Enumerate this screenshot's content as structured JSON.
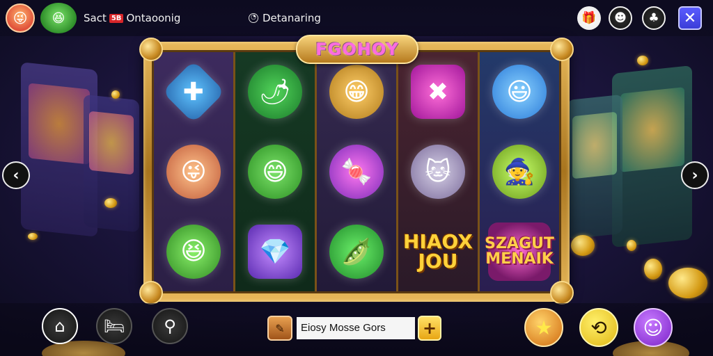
{
  "topbar": {
    "title": "Sact",
    "title_badge": "5B",
    "subtitle": "Ontaoonig",
    "status_text": "Detanaring"
  },
  "game": {
    "title": "FGOHOY",
    "reels": [
      [
        {
          "symbol": "blue-cross-gem",
          "glyph": "✚"
        },
        {
          "symbol": "elf-creature",
          "glyph": "😜"
        },
        {
          "symbol": "green-frog",
          "glyph": "😆"
        }
      ],
      [
        {
          "symbol": "chili-pepper",
          "glyph": "🌶"
        },
        {
          "symbol": "green-blob",
          "glyph": "😄"
        },
        {
          "symbol": "purple-crystal",
          "glyph": "💎"
        }
      ],
      [
        {
          "symbol": "golden-goblin",
          "glyph": "😁"
        },
        {
          "symbol": "candy-orb",
          "glyph": "🍬"
        },
        {
          "symbol": "green-bean",
          "glyph": "🫛"
        }
      ],
      [
        {
          "symbol": "pink-x-gem",
          "glyph": "✖"
        },
        {
          "symbol": "grey-cat",
          "glyph": "🐱"
        },
        {
          "symbol": "word-hiaox-jou",
          "line1": "HIAOX",
          "line2": "JOU"
        }
      ],
      [
        {
          "symbol": "blue-blob",
          "glyph": "😃"
        },
        {
          "symbol": "wizard",
          "glyph": "🧙"
        },
        {
          "symbol": "word-szagut-menaik",
          "line1": "SZAGUT",
          "line2": "MENAIK"
        }
      ]
    ]
  },
  "message_bar": {
    "text": "Eiosy Mosse Gors",
    "plus_label": "+"
  },
  "colors": {
    "accent_gold": "#e8b85a",
    "title_pink": "#ff6adf",
    "close_blue": "#5a5cff"
  }
}
